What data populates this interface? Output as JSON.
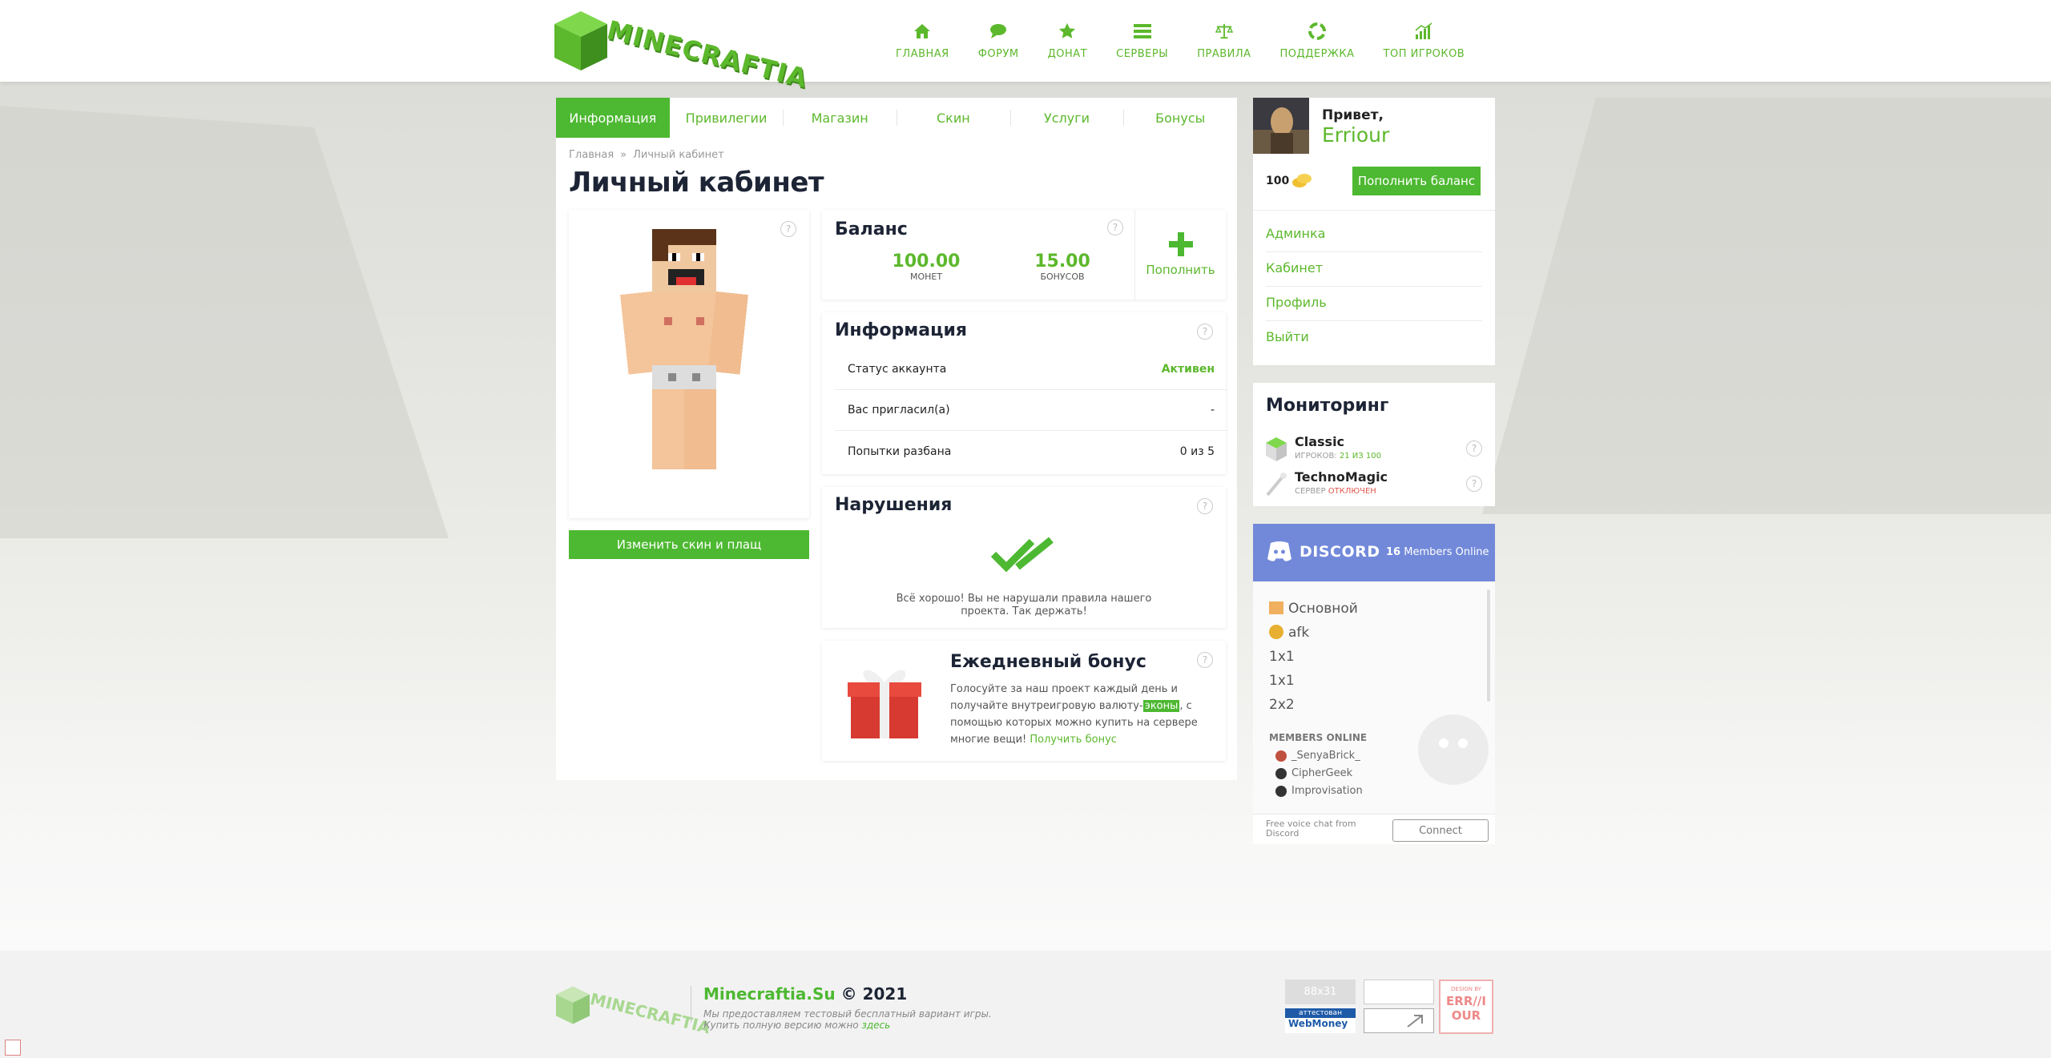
{
  "nav": {
    "items": [
      {
        "label": "ГЛАВНАЯ",
        "icon": "home-icon"
      },
      {
        "label": "ФОРУМ",
        "icon": "chat-icon"
      },
      {
        "label": "ДОНАТ",
        "icon": "star-icon"
      },
      {
        "label": "СЕРВЕРЫ",
        "icon": "server-list-icon"
      },
      {
        "label": "ПРАВИЛА",
        "icon": "scales-icon"
      },
      {
        "label": "ПОДДЕРЖКА",
        "icon": "lifebuoy-icon"
      },
      {
        "label": "ТОП ИГРОКОВ",
        "icon": "bar-chart-icon"
      }
    ],
    "logo_text": "MINECRAFTIA"
  },
  "tabs": [
    "Информация",
    "Привилегии",
    "Магазин",
    "Скин",
    "Услуги",
    "Бонусы"
  ],
  "breadcrumb": {
    "home": "Главная",
    "sep": "»",
    "current": "Личный кабинет"
  },
  "page_title": "Личный кабинет",
  "skin": {
    "change_button": "Изменить скин и плащ",
    "help": "?"
  },
  "balance": {
    "title": "Баланс",
    "coins": "100.00",
    "coins_label": "МОНЕТ",
    "bonuses": "15.00",
    "bonuses_label": "БОНУСОВ",
    "topup": "Пополнить",
    "help": "?"
  },
  "info": {
    "title": "Информация",
    "help": "?",
    "rows": [
      {
        "label": "Статус аккаунта",
        "value": "Активен"
      },
      {
        "label": "Вас пригласил(а)",
        "value": "-"
      },
      {
        "label": "Попытки разбана",
        "value": "0 из 5"
      }
    ]
  },
  "violations": {
    "title": "Нарушения",
    "help": "?",
    "text": "Всё хорошо! Вы не нарушали правила нашего проекта. Так держать!"
  },
  "daily": {
    "title": "Ежедневный бонус",
    "help": "?",
    "text_before": "Голосуйте за наш проект каждый день и получайте внутреигровую валюту-",
    "highlight": "эконы",
    "text_after": ", с помощью которых можно купить на сервере многие вещи!",
    "link": "Получить бонус"
  },
  "user": {
    "greeting": "Привет,",
    "name": "Erriour",
    "balance": "100",
    "topup_button": "Пополнить баланс",
    "links": [
      "Админка",
      "Кабинет",
      "Профиль",
      "Выйти"
    ]
  },
  "monitoring": {
    "title": "Мониторинг",
    "servers": [
      {
        "name": "Classic",
        "status_prefix": "ИГРОКОВ:",
        "status": "21 ИЗ 100",
        "status_color": "#5cb82c"
      },
      {
        "name": "TechnoMagic",
        "status_prefix": "СЕРВЕР",
        "status": "ОТКЛЮЧЕН",
        "status_color": "#e05a4f"
      }
    ]
  },
  "discord": {
    "logo": "DISCORD",
    "members_count": "16",
    "members_label": "Members Online",
    "channels": [
      "Основной",
      "afk",
      "1x1",
      "1x1",
      "2x2"
    ],
    "members_header": "MEMBERS ONLINE",
    "members": [
      "_SenyaBrick_",
      "CipherGeek",
      "Improvisation"
    ],
    "footer_text": "Free voice chat from Discord",
    "connect": "Connect"
  },
  "footer": {
    "site": "Minecraftia.Su",
    "copy": "© 2021",
    "desc": "Мы предоставляем тестовый бесплатный вариант игры. Купить полную версию можно",
    "desc_link": "здесь",
    "badge_88": "88x31",
    "webmoney_top": "аттестован",
    "webmoney": "WebMoney",
    "author_top": "DESIGN BY",
    "author": "ERR//IOUR"
  },
  "colors": {
    "accent": "#4db831",
    "link": "#5cb82c",
    "discord": "#7289da",
    "title": "#1c2435"
  }
}
